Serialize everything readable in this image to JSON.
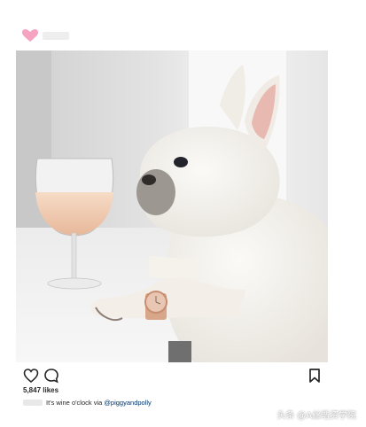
{
  "post": {
    "likes": "5,847 likes",
    "caption_text": "It's wine o'clock via",
    "caption_mention": "@piggyandpolly"
  },
  "icons": {
    "like": "heart-outline-icon",
    "comment": "comment-bubble-icon",
    "save": "bookmark-icon",
    "logo": "heart-logo-icon"
  },
  "colors": {
    "logo_pink": "#f5a3c0",
    "text": "#262626",
    "mention_blue": "#003569"
  },
  "watermark": "头条 @A丝皓资学院"
}
